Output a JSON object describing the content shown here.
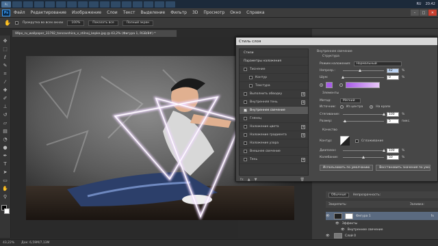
{
  "taskbar": {
    "icons": [
      "Ps",
      "",
      "",
      "",
      "",
      "",
      "",
      "",
      "",
      "",
      "",
      "",
      "",
      "",
      "",
      ""
    ],
    "tray_lang": "RU",
    "tray_time": "20:42"
  },
  "menubar": {
    "logo": "Ps",
    "items": [
      "Файл",
      "Редактирование",
      "Изображение",
      "Слои",
      "Текст",
      "Выделение",
      "Фильтр",
      "3D",
      "Просмотр",
      "Окно",
      "Справка"
    ]
  },
  "options": {
    "scroll_all": "Прокрутка во всех окнах",
    "zoom": "100%",
    "fit": "Показать все",
    "fill": "Полный экран"
  },
  "document": {
    "tab_title": "99px_ru_wallpaper_31792_tancovshica_v_stilnoj_kepke.jpg @ 43,2% (Фигура 1, RGB/8#) *"
  },
  "status": {
    "zoom": "43,22%",
    "doc": "Док: 6,59М/7,13М"
  },
  "dialog": {
    "title": "Стиль слоя",
    "styles": [
      {
        "label": "Стили",
        "checkbox": false,
        "plus": false,
        "selected": false
      },
      {
        "label": "Параметры наложения",
        "checkbox": false,
        "plus": false,
        "selected": false
      },
      {
        "label": "Тиснение",
        "checkbox": true,
        "plus": false,
        "selected": false
      },
      {
        "label": "Контур",
        "checkbox": true,
        "plus": false,
        "selected": false,
        "indent": true
      },
      {
        "label": "Текстура",
        "checkbox": true,
        "plus": false,
        "selected": false,
        "indent": true
      },
      {
        "label": "Выполнить обводку",
        "checkbox": true,
        "plus": true,
        "selected": false
      },
      {
        "label": "Внутренняя тень",
        "checkbox": true,
        "plus": true,
        "selected": false
      },
      {
        "label": "Внутреннее свечение",
        "checkbox": true,
        "plus": false,
        "selected": true,
        "checked": true
      },
      {
        "label": "Глянец",
        "checkbox": true,
        "plus": false,
        "selected": false
      },
      {
        "label": "Наложение цвета",
        "checkbox": true,
        "plus": true,
        "selected": false
      },
      {
        "label": "Наложение градиента",
        "checkbox": true,
        "plus": true,
        "selected": false
      },
      {
        "label": "Наложение узора",
        "checkbox": true,
        "plus": false,
        "selected": false
      },
      {
        "label": "Внешнее свечение",
        "checkbox": true,
        "plus": false,
        "selected": false
      },
      {
        "label": "Тень",
        "checkbox": true,
        "plus": true,
        "selected": false
      }
    ],
    "fx_label": "fx",
    "section_title": "Внутреннее свечение",
    "structure_label": "Структура",
    "blend_mode_label": "Режим наложения:",
    "blend_mode_value": "Нормальный",
    "opacity_label": "Непрозр.:",
    "opacity_value": "42",
    "noise_label": "Шум:",
    "noise_value": "0",
    "percent": "%",
    "elements_label": "Элементы",
    "method_label": "Метод:",
    "method_value": "Мягкий",
    "source_label": "Источник:",
    "source_center": "Из центра",
    "source_edge": "На краях",
    "choke_label": "Стягивание:",
    "choke_value": "100",
    "size_label": "Размер:",
    "size_value": "5",
    "pix": "пикс.",
    "quality_label": "Качество",
    "contour_label": "Контур:",
    "antialias_label": "Сглаживание",
    "range_label": "Диапазон:",
    "range_value": "100",
    "jitter_label": "Колебание:",
    "jitter_value": "50",
    "default_btn": "Использовать по умолчанию",
    "reset_btn": "Восстановить значения по умолчанию",
    "glow_color": "#a85ce8",
    "gradient_to": "#e8c8f8"
  },
  "layers": {
    "normal_label": "Обычные",
    "opacity_label": "Непрозрачность:",
    "lock_label": "Закрепить:",
    "fill_label": "Заливка:",
    "items": [
      {
        "name": "Фигура 1"
      },
      {
        "name": "Эффекты"
      },
      {
        "name": "Внутреннее свечение"
      },
      {
        "name": "Слой 0"
      }
    ]
  }
}
